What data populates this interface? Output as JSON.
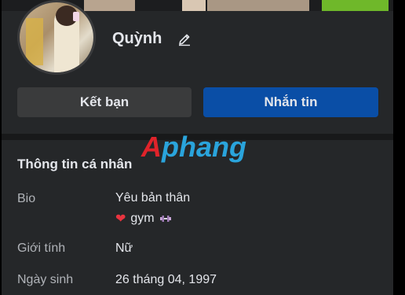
{
  "profile": {
    "name": "Quỳnh"
  },
  "actions": {
    "add_friend_label": "Kết bạn",
    "message_label": "Nhắn tin"
  },
  "watermark": {
    "first": "A",
    "rest": "phang"
  },
  "about": {
    "section_title": "Thông tin cá nhân",
    "bio_label": "Bio",
    "bio_line1": "Yêu bản thân",
    "bio_line2_text": "gym",
    "bio_heart": "❤",
    "gender_label": "Giới tính",
    "gender_value": "Nữ",
    "birthday_label": "Ngày sinh",
    "birthday_value": "26 tháng 04, 1997"
  },
  "icons": {
    "edit": "pencil-icon",
    "heart": "heart-icon",
    "dumbbell": "dumbbell-icon"
  },
  "colors": {
    "panel_bg": "#252729",
    "primary_button": "#0a4ea6",
    "secondary_button": "#3a3b3c",
    "text_primary": "#e4e6eb",
    "text_secondary": "#b0b3b8",
    "heart": "#e8343f",
    "watermark_red": "#e0232a",
    "watermark_blue": "#2aa4dc"
  }
}
